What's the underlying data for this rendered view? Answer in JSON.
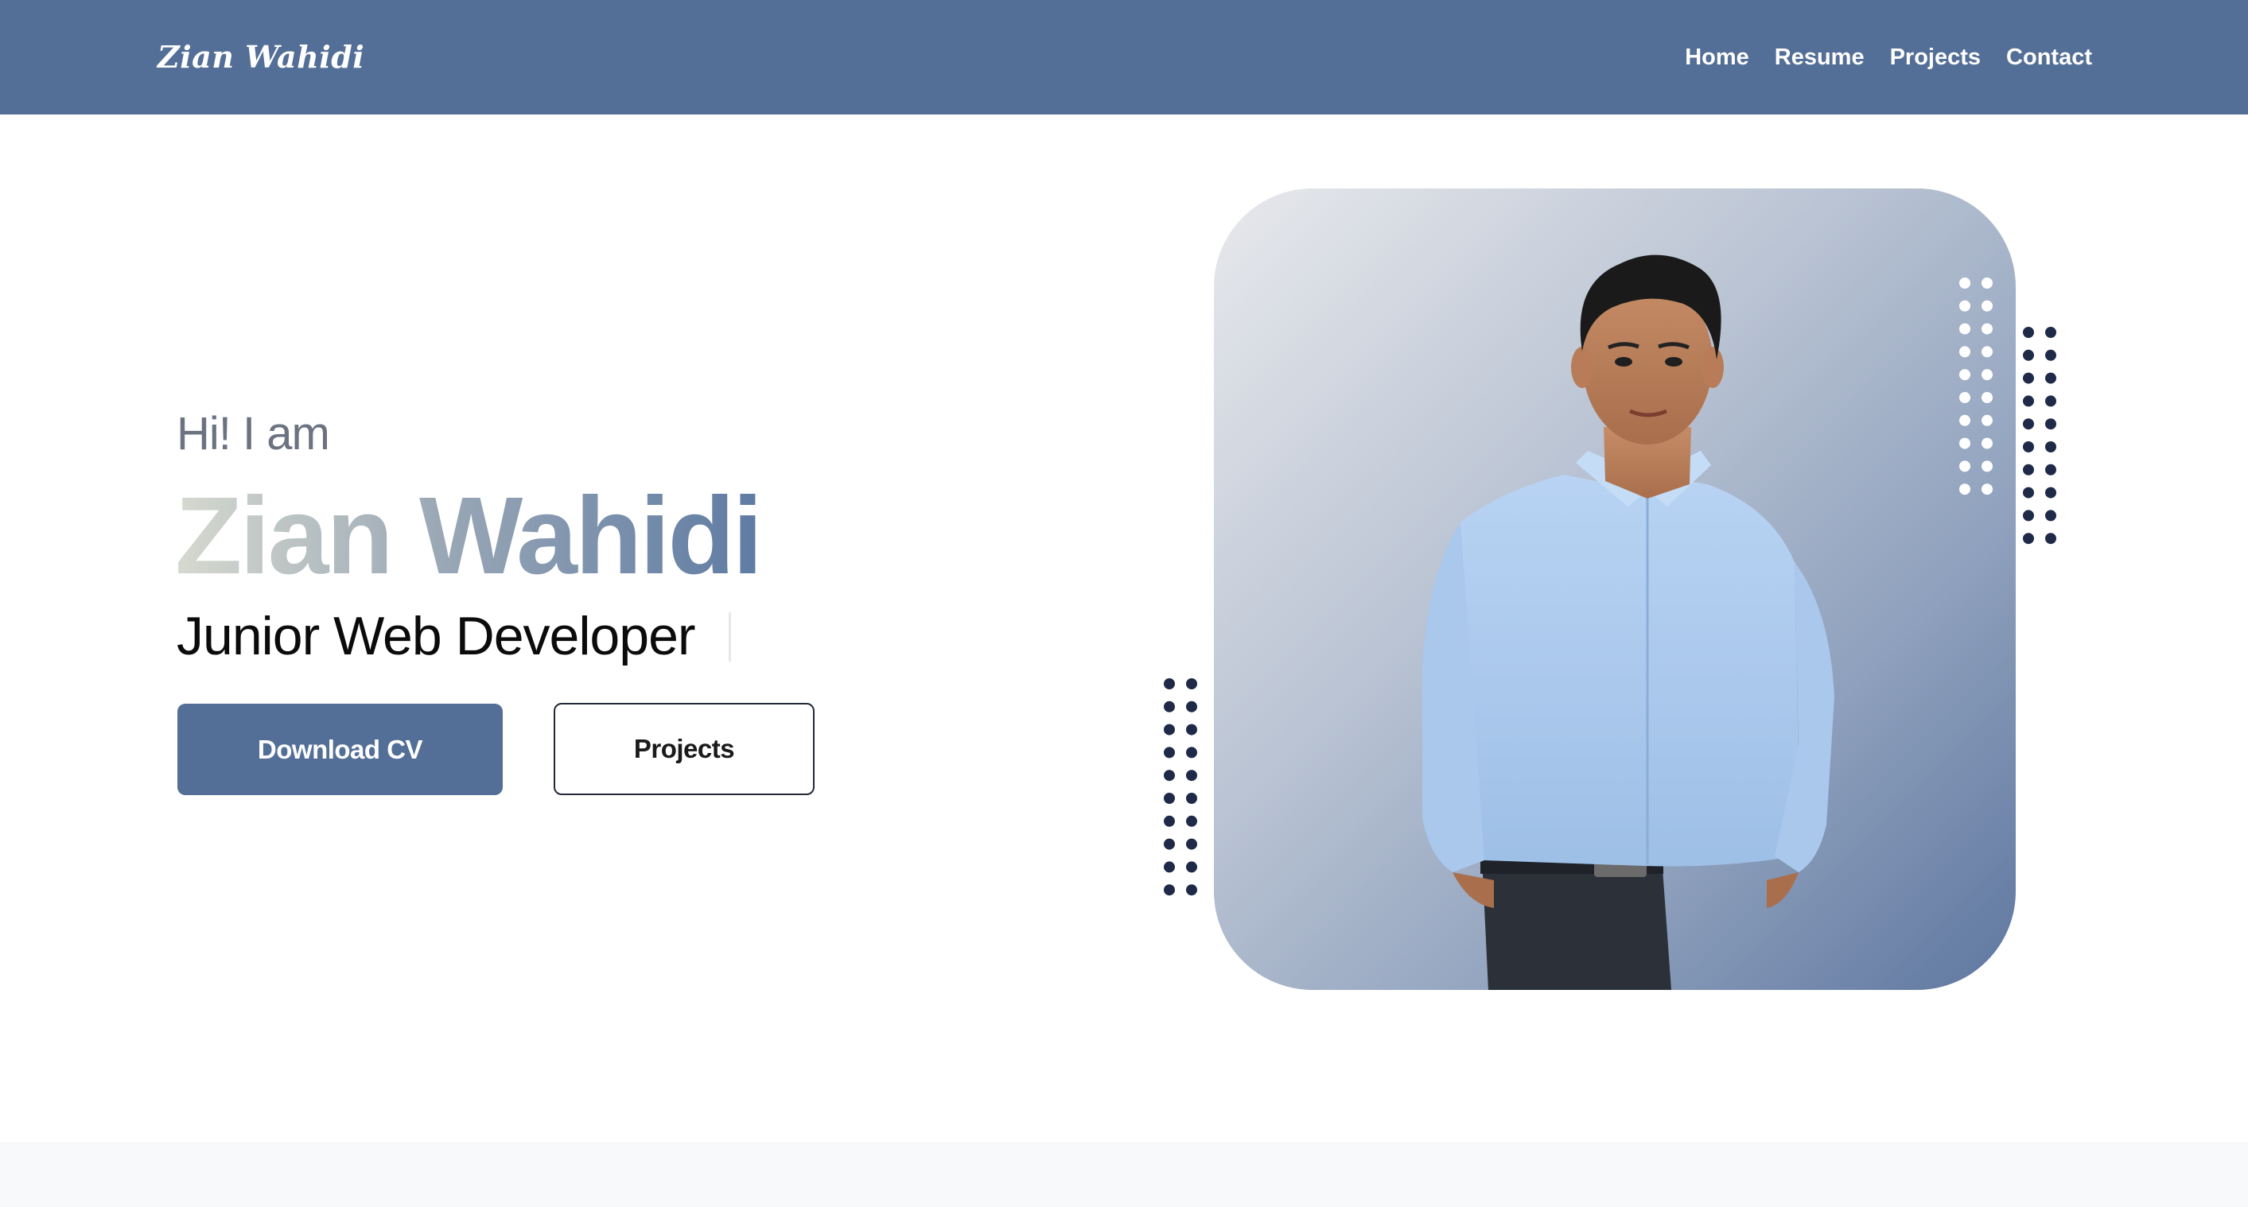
{
  "header": {
    "brand": "Zian Wahidi",
    "nav": [
      {
        "label": "Home"
      },
      {
        "label": "Resume"
      },
      {
        "label": "Projects"
      },
      {
        "label": "Contact"
      }
    ],
    "background": "#546f97"
  },
  "hero": {
    "greeting": "Hi! I am",
    "name": "Zian Wahidi",
    "role": "Junior  Web Developer",
    "buttons": {
      "download": "Download CV",
      "projects": "Projects"
    },
    "accent": "#546f97",
    "photo_alt": "portrait-photo"
  }
}
